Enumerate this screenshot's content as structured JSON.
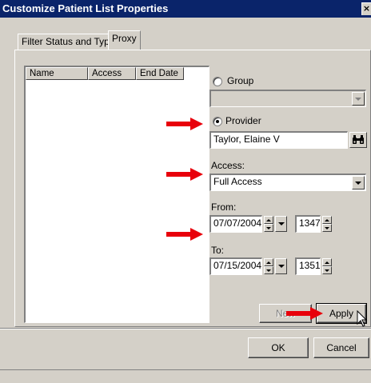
{
  "window": {
    "title": "Customize Patient List Properties",
    "close_glyph": "×"
  },
  "tabs": [
    {
      "label": "Filter Status and Type",
      "active": false
    },
    {
      "label": "Proxy",
      "active": true
    }
  ],
  "list": {
    "columns": [
      "Name",
      "Access",
      "End Date"
    ]
  },
  "group": {
    "label": "Group",
    "value": ""
  },
  "provider": {
    "label": "Provider",
    "value": "Taylor, Elaine V"
  },
  "access": {
    "label": "Access:",
    "value": "Full Access"
  },
  "from": {
    "label": "From:",
    "date": "07/07/2004",
    "time": "1347"
  },
  "to": {
    "label": "To:",
    "date": "07/15/2004",
    "time": "1351"
  },
  "buttons": {
    "new": "New",
    "apply": "Apply",
    "ok": "OK",
    "cancel": "Cancel"
  },
  "colors": {
    "title_bar": "#0a246a",
    "arrow": "#e8000b",
    "face": "#d4d0c8"
  },
  "icons": [
    "binoculars-icon",
    "arrow-annotation",
    "mouse-cursor-icon"
  ]
}
